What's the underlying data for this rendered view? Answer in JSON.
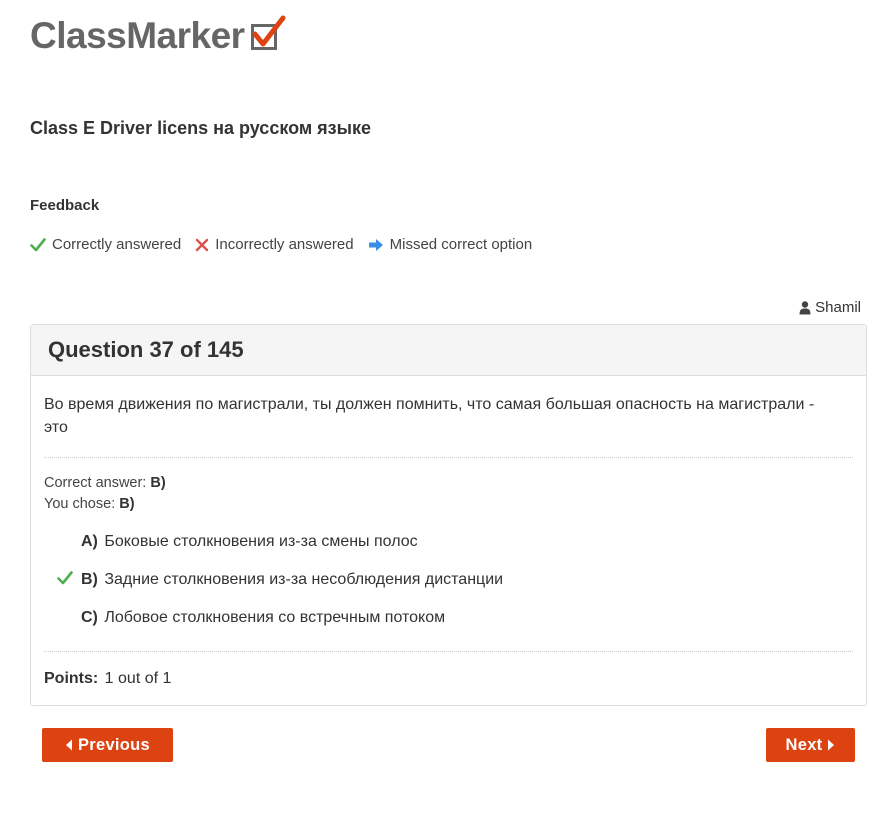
{
  "brand": {
    "name": "ClassMarker"
  },
  "quiz": {
    "title": "Class E Driver licens на русском языке"
  },
  "feedback": {
    "heading": "Feedback",
    "legend": [
      {
        "icon": "check-icon",
        "label": "Correctly answered",
        "color": "#4cae4c"
      },
      {
        "icon": "cross-icon",
        "label": "Incorrectly answered",
        "color": "#d9534f"
      },
      {
        "icon": "arrow-right-icon",
        "label": "Missed correct option",
        "color": "#3a8ee6"
      }
    ]
  },
  "user": {
    "icon": "user-icon",
    "name": "Shamil"
  },
  "question": {
    "header": "Question 37 of 145",
    "text": "Во время движения по магистрали, ты должен помнить, что самая большая опасность на магистрали - это",
    "correct_answer_label": "Correct answer:",
    "correct_answer_value": "B)",
    "you_chose_label": "You chose:",
    "you_chose_value": "B)",
    "options": [
      {
        "letter": "A)",
        "text": "Боковые столкновения из-за смены полос",
        "checked": false
      },
      {
        "letter": "B)",
        "text": "Задние столкновения из-за несоблюдения дистанции",
        "checked": true
      },
      {
        "letter": "C)",
        "text": "Лобовое столкновения со встречным потоком",
        "checked": false
      }
    ],
    "points_label": "Points:",
    "points_value": "1 out of 1"
  },
  "nav": {
    "previous_label": "Previous",
    "next_label": "Next",
    "button_color": "#dc4311"
  }
}
